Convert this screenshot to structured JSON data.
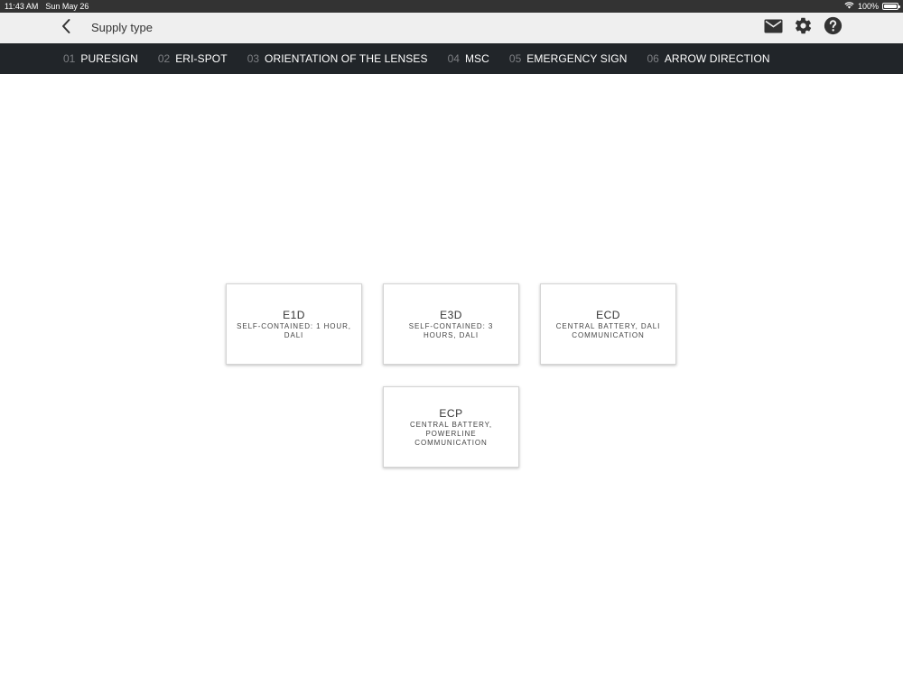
{
  "status_bar": {
    "time": "11:43 AM",
    "date": "Sun May 26",
    "battery_text": "100%",
    "battery_level": 1.0,
    "wifi_icon": "wifi-icon"
  },
  "header": {
    "back_icon": "chevron-left-icon",
    "title": "Supply type",
    "actions": [
      "mail-icon",
      "gear-icon",
      "help-icon"
    ]
  },
  "steps": [
    {
      "num": "01",
      "label": "PURESIGN"
    },
    {
      "num": "02",
      "label": "ERI-SPOT"
    },
    {
      "num": "03",
      "label": "ORIENTATION OF THE LENSES"
    },
    {
      "num": "04",
      "label": "MSC"
    },
    {
      "num": "05",
      "label": "EMERGENCY SIGN"
    },
    {
      "num": "06",
      "label": "ARROW DIRECTION"
    }
  ],
  "options": [
    {
      "code": "E1D",
      "desc": "SELF-CONTAINED: 1 HOUR, DALI"
    },
    {
      "code": "E3D",
      "desc": "SELF-CONTAINED: 3 HOURS, DALI"
    },
    {
      "code": "ECD",
      "desc": "CENTRAL BATTERY, DALI COMMUNICATION"
    },
    {
      "code": "ECP",
      "desc": "CENTRAL BATTERY, POWERLINE COMMUNICATION"
    }
  ],
  "colors": {
    "status_bar_bg": "#333333",
    "header_bg": "#efefef",
    "nav_bg": "#212529",
    "nav_number": "#7d7f83",
    "nav_label": "#ffffff"
  }
}
